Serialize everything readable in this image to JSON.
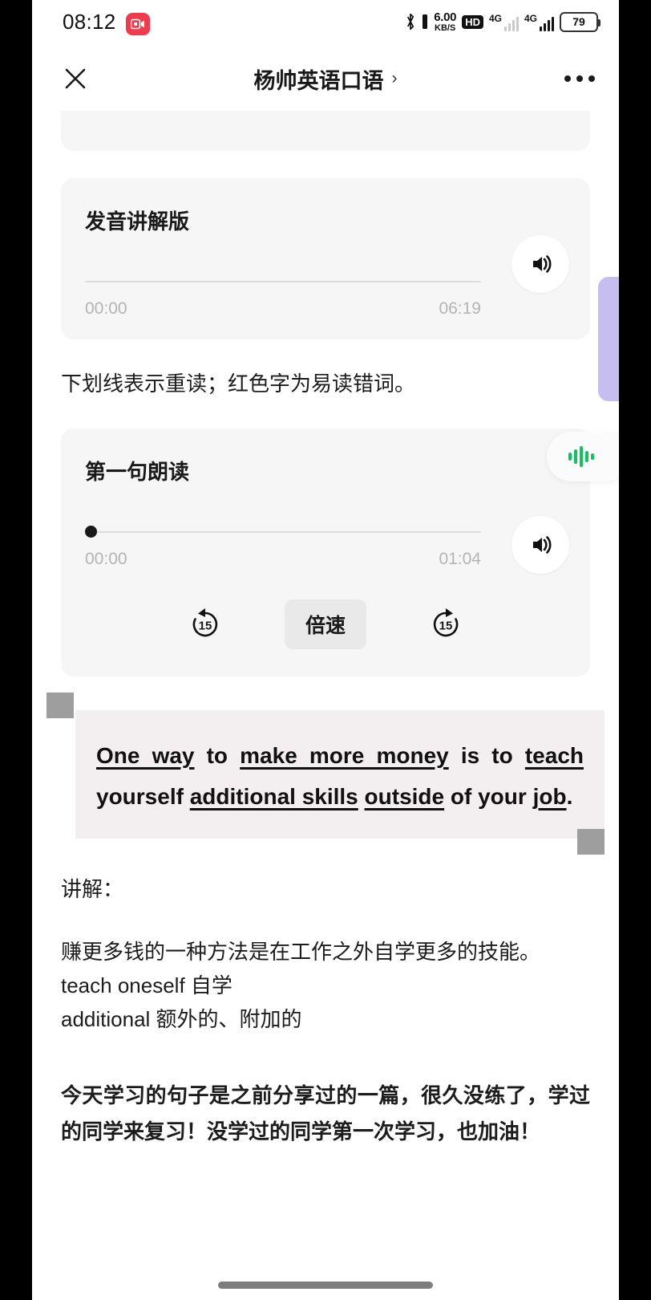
{
  "status_bar": {
    "time": "08:12",
    "record_icon": "screen-record-icon",
    "bluetooth_icon": "bluetooth-icon",
    "net_speed_value": "6.00",
    "net_speed_unit": "KB/S",
    "hd_badge": "HD",
    "signal_1_label": "4G",
    "signal_2_label": "4G",
    "battery_level": "79"
  },
  "nav": {
    "close_icon": "close-icon",
    "title": "杨帅英语口语",
    "chevron": "›",
    "more_icon": "more-options-icon"
  },
  "audio_cards": [
    {
      "title": "发音讲解版",
      "current_time": "00:00",
      "total_time": "06:19",
      "progress_percent": 0,
      "has_controls": false,
      "speaker_icon": "speaker-icon"
    },
    {
      "title": "第一句朗读",
      "current_time": "00:00",
      "total_time": "01:04",
      "progress_percent": 0,
      "has_controls": true,
      "speaker_icon": "speaker-icon",
      "rewind_label": "15",
      "forward_label": "15",
      "speed_label": "倍速"
    }
  ],
  "note_line": "下划线表示重读；红色字为易读错词。",
  "quote": {
    "parts": [
      {
        "text": "One way",
        "underline": true
      },
      {
        "text": " to ",
        "underline": false
      },
      {
        "text": "make more money",
        "underline": true
      },
      {
        "text": " is to ",
        "underline": false
      },
      {
        "text": "teach",
        "underline": true
      },
      {
        "text": " yourself ",
        "underline": false
      },
      {
        "text": "additional skills",
        "underline": true
      },
      {
        "text": " ",
        "underline": false
      },
      {
        "text": "outside",
        "underline": true
      },
      {
        "text": " of your ",
        "underline": false
      },
      {
        "text": "job",
        "underline": true
      },
      {
        "text": ".",
        "underline": false
      }
    ],
    "selection_handle_top": "selection-handle",
    "selection_handle_bottom": "selection-handle"
  },
  "explain": {
    "heading": "讲解：",
    "translation": "赚更多钱的一种方法是在工作之外自学更多的技能。",
    "vocab": [
      "teach oneself 自学",
      "additional 额外的、附加的"
    ]
  },
  "closing": "今天学习的句子是之前分享过的一篇，很久没练了，学过的同学来复习！没学过的同学第一次学习，也加油！",
  "floating": {
    "purple_tab": "purple-side-tab",
    "wave_icon": "audio-wave-icon"
  },
  "colors": {
    "card_bg": "#f6f6f6",
    "quote_bg": "#f3eff0",
    "accent_green": "#13c163",
    "accent_purple": "#c7bdf0",
    "record_red": "#ef3b4b"
  }
}
